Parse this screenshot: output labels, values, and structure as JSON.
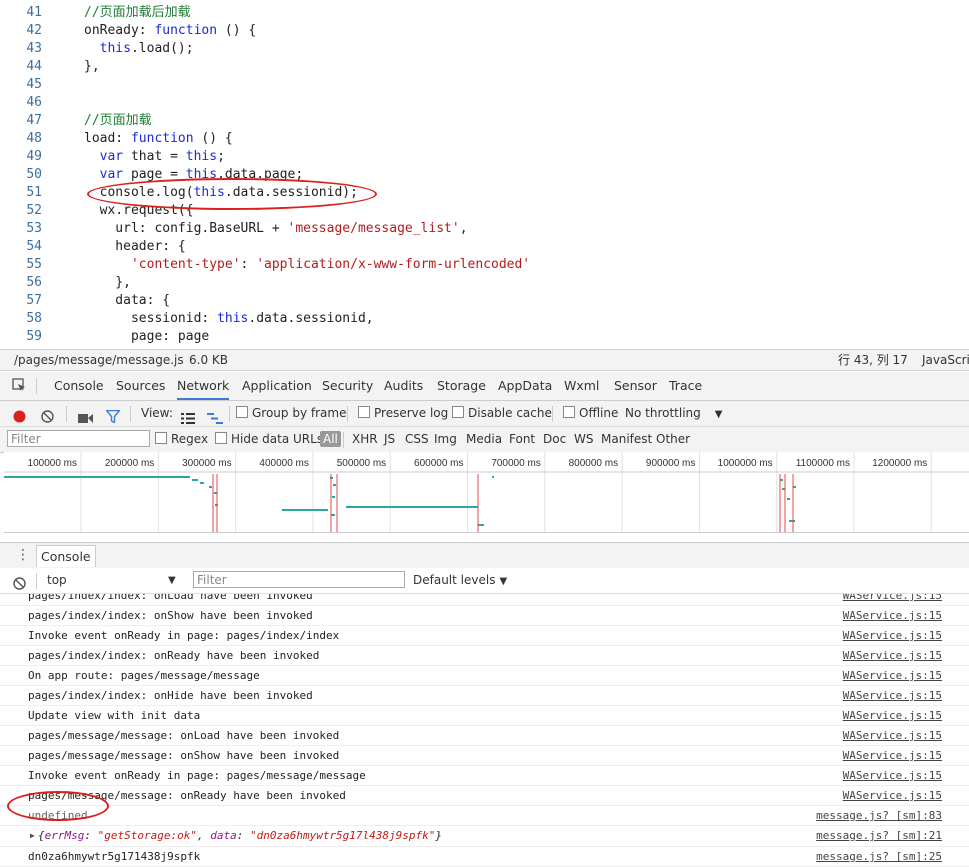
{
  "editor": {
    "lines": [
      {
        "n": "41",
        "tokens": [
          {
            "t": "//页面加载后加载",
            "c": "cm"
          }
        ]
      },
      {
        "n": "42",
        "tokens": [
          {
            "t": "onReady: ",
            "c": ""
          },
          {
            "t": "function",
            "c": "kw"
          },
          {
            "t": " () {",
            "c": ""
          }
        ]
      },
      {
        "n": "43",
        "tokens": [
          {
            "t": "  ",
            "c": ""
          },
          {
            "t": "this",
            "c": "kw"
          },
          {
            "t": ".load();",
            "c": ""
          }
        ]
      },
      {
        "n": "44",
        "tokens": [
          {
            "t": "},",
            "c": ""
          }
        ]
      },
      {
        "n": "45",
        "tokens": []
      },
      {
        "n": "46",
        "tokens": []
      },
      {
        "n": "47",
        "tokens": [
          {
            "t": "//页面加载",
            "c": "cm"
          }
        ]
      },
      {
        "n": "48",
        "tokens": [
          {
            "t": "load: ",
            "c": ""
          },
          {
            "t": "function",
            "c": "kw"
          },
          {
            "t": " () {",
            "c": ""
          }
        ]
      },
      {
        "n": "49",
        "tokens": [
          {
            "t": "  ",
            "c": ""
          },
          {
            "t": "var",
            "c": "kw"
          },
          {
            "t": " that = ",
            "c": ""
          },
          {
            "t": "this",
            "c": "kw"
          },
          {
            "t": ";",
            "c": ""
          }
        ]
      },
      {
        "n": "50",
        "tokens": [
          {
            "t": "  ",
            "c": ""
          },
          {
            "t": "var",
            "c": "kw"
          },
          {
            "t": " page = ",
            "c": ""
          },
          {
            "t": "this",
            "c": "kw"
          },
          {
            "t": ".data.page;",
            "c": ""
          }
        ]
      },
      {
        "n": "51",
        "tokens": [
          {
            "t": "  console.log(",
            "c": ""
          },
          {
            "t": "this",
            "c": "kw"
          },
          {
            "t": ".data.sessionid);",
            "c": ""
          }
        ]
      },
      {
        "n": "52",
        "tokens": [
          {
            "t": "  wx.request({",
            "c": ""
          }
        ]
      },
      {
        "n": "53",
        "tokens": [
          {
            "t": "    url: config.BaseURL + ",
            "c": ""
          },
          {
            "t": "'message/message_list'",
            "c": "str"
          },
          {
            "t": ",",
            "c": ""
          }
        ]
      },
      {
        "n": "54",
        "tokens": [
          {
            "t": "    header: {",
            "c": ""
          }
        ]
      },
      {
        "n": "55",
        "tokens": [
          {
            "t": "      ",
            "c": ""
          },
          {
            "t": "'content-type'",
            "c": "str"
          },
          {
            "t": ": ",
            "c": ""
          },
          {
            "t": "'application/x-www-form-urlencoded'",
            "c": "str"
          }
        ]
      },
      {
        "n": "56",
        "tokens": [
          {
            "t": "    },",
            "c": ""
          }
        ]
      },
      {
        "n": "57",
        "tokens": [
          {
            "t": "    data: {",
            "c": ""
          }
        ]
      },
      {
        "n": "58",
        "tokens": [
          {
            "t": "      sessionid: ",
            "c": ""
          },
          {
            "t": "this",
            "c": "kw"
          },
          {
            "t": ".data.sessionid,",
            "c": ""
          }
        ]
      },
      {
        "n": "59",
        "tokens": [
          {
            "t": "      page: page",
            "c": ""
          }
        ]
      }
    ],
    "status": {
      "path": "/pages/message/message.js",
      "size": "6.0 KB",
      "position": "行 43, 列 17",
      "language": "JavaScri"
    }
  },
  "devtools": {
    "tabs": [
      "Console",
      "Sources",
      "Network",
      "Application",
      "Security",
      "Audits",
      "Storage",
      "AppData",
      "Wxml",
      "Sensor",
      "Trace"
    ],
    "active_tab": "Network"
  },
  "network": {
    "view_label": "View:",
    "group_by_frame": "Group by frame",
    "preserve_log": "Preserve log",
    "disable_cache": "Disable cache",
    "offline": "Offline",
    "throttling": "No throttling",
    "filter_placeholder": "Filter",
    "regex": "Regex",
    "hide_data_urls": "Hide data URLs",
    "types": [
      "All",
      "XHR",
      "JS",
      "CSS",
      "Img",
      "Media",
      "Font",
      "Doc",
      "WS",
      "Manifest",
      "Other"
    ],
    "timeline_ticks": [
      "100000 ms",
      "200000 ms",
      "300000 ms",
      "400000 ms",
      "500000 ms",
      "600000 ms",
      "700000 ms",
      "800000 ms",
      "900000 ms",
      "1000000 ms",
      "1100000 ms",
      "1200000 ms",
      "130"
    ]
  },
  "console": {
    "tab_label": "Console",
    "context": "top",
    "filter_placeholder": "Filter",
    "levels": "Default levels",
    "messages": [
      {
        "text": "pages/index/index: onLoad have been invoked",
        "source": "WAService.js:15"
      },
      {
        "text": "pages/index/index: onShow have been invoked",
        "source": "WAService.js:15"
      },
      {
        "text": "Invoke event onReady in page: pages/index/index",
        "source": "WAService.js:15"
      },
      {
        "text": "pages/index/index: onReady have been invoked",
        "source": "WAService.js:15"
      },
      {
        "text": "On app route: pages/message/message",
        "source": "WAService.js:15"
      },
      {
        "text": "pages/index/index: onHide have been invoked",
        "source": "WAService.js:15"
      },
      {
        "text": "Update view with init data",
        "source": "WAService.js:15"
      },
      {
        "text": "pages/message/message: onLoad have been invoked",
        "source": "WAService.js:15"
      },
      {
        "text": "pages/message/message: onShow have been invoked",
        "source": "WAService.js:15"
      },
      {
        "text": "Invoke event onReady in page: pages/message/message",
        "source": "WAService.js:15"
      },
      {
        "text": "pages/message/message: onReady have been invoked",
        "source": "WAService.js:15"
      }
    ],
    "undefined_msg": {
      "text": "undefined",
      "source": "message.js? [sm]:83"
    },
    "object_msg": {
      "key1": "errMsg",
      "val1": "\"getStorage:ok\"",
      "key2": "data",
      "val2": "\"dn0za6hmywtr5g17l438j9spfk\"",
      "source": "message.js? [sm]:21"
    },
    "session_msg": {
      "text": "dn0za6hmywtr5g171438j9spfk",
      "source": "message.js? [sm]:25"
    },
    "prompt": ">"
  },
  "colors": {
    "accent": "#3b7bd8",
    "annotation": "#d9211d",
    "record": "#d9211d"
  }
}
